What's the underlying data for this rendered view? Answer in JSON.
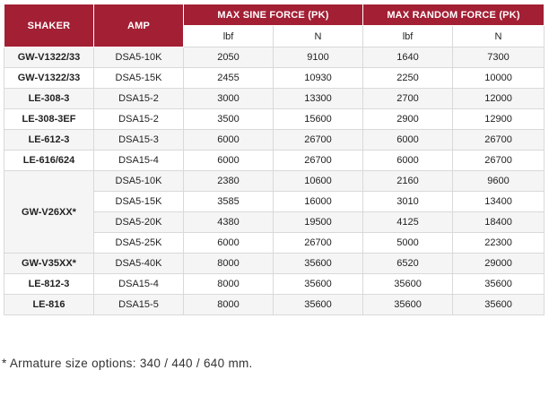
{
  "headers": {
    "shaker": "SHAKER",
    "amp": "AMP",
    "sine": "MAX SINE FORCE (PK)",
    "random": "MAX RANDOM FORCE (PK)"
  },
  "units": {
    "sine_lbf": "lbf",
    "sine_n": "N",
    "random_lbf": "lbf",
    "random_n": "N"
  },
  "rows": [
    {
      "shaker": "GW-V1322/33",
      "amp": "DSA5-10K",
      "sine_lbf": "2050",
      "sine_n": "9100",
      "random_lbf": "1640",
      "random_n": "7300"
    },
    {
      "shaker": "GW-V1322/33",
      "amp": "DSA5-15K",
      "sine_lbf": "2455",
      "sine_n": "10930",
      "random_lbf": "2250",
      "random_n": "10000"
    },
    {
      "shaker": "LE-308-3",
      "amp": "DSA15-2",
      "sine_lbf": "3000",
      "sine_n": "13300",
      "random_lbf": "2700",
      "random_n": "12000"
    },
    {
      "shaker": "LE-308-3EF",
      "amp": "DSA15-2",
      "sine_lbf": "3500",
      "sine_n": "15600",
      "random_lbf": "2900",
      "random_n": "12900"
    },
    {
      "shaker": "LE-612-3",
      "amp": "DSA15-3",
      "sine_lbf": "6000",
      "sine_n": "26700",
      "random_lbf": "6000",
      "random_n": "26700"
    },
    {
      "shaker": "LE-616/624",
      "amp": "DSA15-4",
      "sine_lbf": "6000",
      "sine_n": "26700",
      "random_lbf": "6000",
      "random_n": "26700"
    }
  ],
  "group": {
    "shaker": "GW-V26XX*",
    "rows": [
      {
        "amp": "DSA5-10K",
        "sine_lbf": "2380",
        "sine_n": "10600",
        "random_lbf": "2160",
        "random_n": "9600"
      },
      {
        "amp": "DSA5-15K",
        "sine_lbf": "3585",
        "sine_n": "16000",
        "random_lbf": "3010",
        "random_n": "13400"
      },
      {
        "amp": "DSA5-20K",
        "sine_lbf": "4380",
        "sine_n": "19500",
        "random_lbf": "4125",
        "random_n": "18400"
      },
      {
        "amp": "DSA5-25K",
        "sine_lbf": "6000",
        "sine_n": "26700",
        "random_lbf": "5000",
        "random_n": "22300"
      }
    ]
  },
  "rows_after": [
    {
      "shaker": "GW-V35XX*",
      "amp": "DSA5-40K",
      "sine_lbf": "8000",
      "sine_n": "35600",
      "random_lbf": "6520",
      "random_n": "29000"
    },
    {
      "shaker": "LE-812-3",
      "amp": "DSA15-4",
      "sine_lbf": "8000",
      "sine_n": "35600",
      "random_lbf": "35600",
      "random_n": "35600"
    },
    {
      "shaker": "LE-816",
      "amp": "DSA15-5",
      "sine_lbf": "8000",
      "sine_n": "35600",
      "random_lbf": "35600",
      "random_n": "35600"
    }
  ],
  "footnote": "* Armature size options: 340 / 440 / 640 mm.",
  "colors": {
    "header_bg": "#a31f34",
    "header_text": "#ffffff",
    "row_alt": "#f5f5f5"
  }
}
